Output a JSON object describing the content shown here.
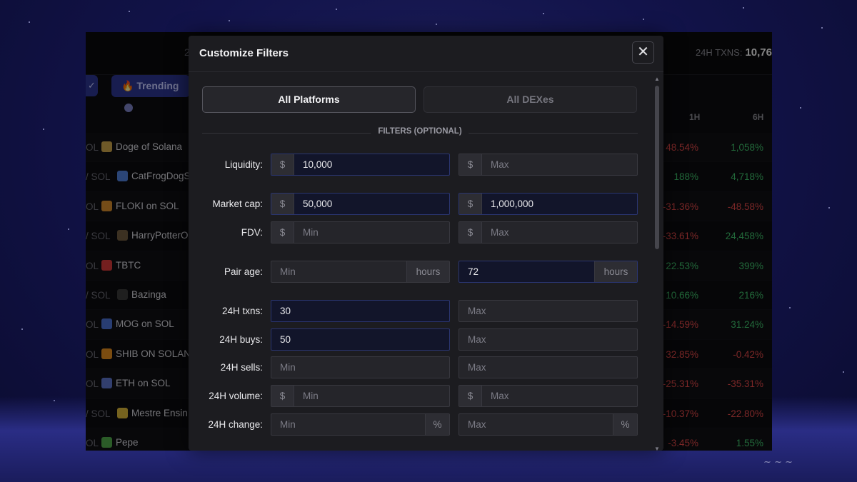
{
  "background_app": {
    "topbar_partial_number": "2",
    "txns_label": "24H TXNS:",
    "txns_value": "10,76",
    "trending_label": "Trending",
    "check_icon": "check-icon",
    "columns": {
      "h1": "1H",
      "h6": "6H"
    },
    "rows": [
      {
        "chain": "OL",
        "name": "Doge of Solana",
        "h1": "48.54%",
        "h6": "1,058%",
        "h1_sign": "neg",
        "h6_sign": "pos",
        "icon_color": "#c8a24a"
      },
      {
        "chain": "/ SOL",
        "name": "CatFrogDogS",
        "h1": "188%",
        "h6": "4,718%",
        "h1_sign": "pos",
        "h6_sign": "pos",
        "icon_color": "#4f7fd8"
      },
      {
        "chain": "OL",
        "name": "FLOKI on SOL",
        "h1": "-31.36%",
        "h6": "-48.58%",
        "h1_sign": "neg",
        "h6_sign": "neg",
        "icon_color": "#d48b2c"
      },
      {
        "chain": "/ SOL",
        "name": "HarryPotterOl",
        "h1": "-33.61%",
        "h6": "24,458%",
        "h1_sign": "neg",
        "h6_sign": "pos",
        "icon_color": "#6e5a3e"
      },
      {
        "chain": "OL",
        "name": "TBTC",
        "h1": "22.53%",
        "h6": "399%",
        "h1_sign": "pos",
        "h6_sign": "pos",
        "icon_color": "#d43a3a"
      },
      {
        "chain": "/ SOL",
        "name": "Bazinga",
        "h1": "10.66%",
        "h6": "216%",
        "h1_sign": "pos",
        "h6_sign": "pos",
        "icon_color": "#3a3a3a"
      },
      {
        "chain": "OL",
        "name": "MOG on SOL",
        "h1": "-14.59%",
        "h6": "31.24%",
        "h1_sign": "neg",
        "h6_sign": "pos",
        "icon_color": "#4a6fcf"
      },
      {
        "chain": "OL",
        "name": "SHIB ON SOLANA",
        "h1": "32.85%",
        "h6": "-0.42%",
        "h1_sign": "neg",
        "h6_sign": "neg",
        "icon_color": "#e08a1e"
      },
      {
        "chain": "OL",
        "name": "ETH on SOL",
        "h1": "-25.31%",
        "h6": "-35.31%",
        "h1_sign": "neg",
        "h6_sign": "neg",
        "icon_color": "#5b73c9"
      },
      {
        "chain": "/ SOL",
        "name": "Mestre Ensin",
        "h1": "-10.37%",
        "h6": "-22.80%",
        "h1_sign": "neg",
        "h6_sign": "neg",
        "icon_color": "#d8b43a"
      },
      {
        "chain": "OL",
        "name": "Pepe",
        "h1": "-3.45%",
        "h6": "1.55%",
        "h1_sign": "neg",
        "h6_sign": "pos",
        "icon_color": "#4fa84a"
      }
    ]
  },
  "modal": {
    "title": "Customize Filters",
    "close_icon": "close-icon",
    "tabs": [
      {
        "label": "All Platforms",
        "active": true
      },
      {
        "label": "All DEXes",
        "active": false
      }
    ],
    "section_label": "FILTERS (OPTIONAL)",
    "filters": {
      "liquidity": {
        "label": "Liquidity:",
        "prefix": "$",
        "min": "10,000",
        "max_placeholder": "Max"
      },
      "market_cap": {
        "label": "Market cap:",
        "prefix": "$",
        "min": "50,000",
        "max": "1,000,000"
      },
      "fdv": {
        "label": "FDV:",
        "prefix": "$",
        "min_placeholder": "Min",
        "max_placeholder": "Max"
      },
      "pair_age": {
        "label": "Pair age:",
        "suffix": "hours",
        "min_placeholder": "Min",
        "max": "72"
      },
      "txns_24h": {
        "label": "24H txns:",
        "min": "30",
        "max_placeholder": "Max"
      },
      "buys_24h": {
        "label": "24H buys:",
        "min": "50",
        "max_placeholder": "Max"
      },
      "sells_24h": {
        "label": "24H sells:",
        "min_placeholder": "Min",
        "max_placeholder": "Max"
      },
      "volume_24h": {
        "label": "24H volume:",
        "prefix": "$",
        "min_placeholder": "Min",
        "max_placeholder": "Max"
      },
      "change_24h": {
        "label": "24H change:",
        "suffix": "%",
        "min_placeholder": "Min",
        "max_placeholder": "Max"
      }
    }
  },
  "colors": {
    "accent": "#2c3590",
    "positive": "#3fbf6a",
    "negative": "#e04848",
    "modal_bg": "#1c1c20",
    "filled_field_bg": "#12152a"
  }
}
